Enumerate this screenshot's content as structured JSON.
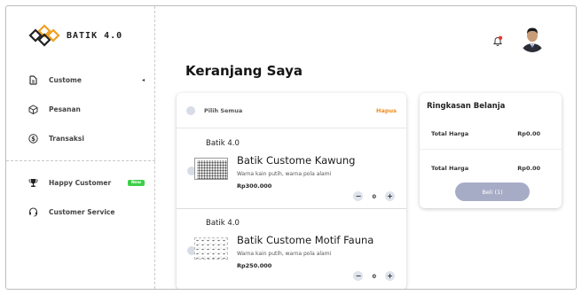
{
  "brand": {
    "name": "BATIK 4.0"
  },
  "sidebar": {
    "items": [
      {
        "label": "Custome",
        "icon": "ruler-icon"
      },
      {
        "label": "Pesanan",
        "icon": "box-icon"
      },
      {
        "label": "Transaksi",
        "icon": "dollar-icon"
      },
      {
        "label": "Happy Customer",
        "icon": "trophy-icon",
        "badge": "New"
      },
      {
        "label": "Customer Service",
        "icon": "headset-icon"
      }
    ]
  },
  "header": {
    "title": "Keranjang Saya"
  },
  "cart": {
    "select_all_label": "Pilih Semua",
    "delete_label": "Hapus",
    "items": [
      {
        "store": "Batik 4.0",
        "name": "Batik Custome Kawung",
        "description": "Warna kain putih, warna pola alami",
        "price": "Rp300.000",
        "quantity": "0"
      },
      {
        "store": "Batik 4.0",
        "name": "Batik Custome Motif Fauna",
        "description": "Warna kain putih, warna pola alami",
        "price": "Rp250.000",
        "quantity": "0"
      }
    ],
    "minus": "−",
    "plus": "+"
  },
  "summary": {
    "title": "Ringkasan Belanja",
    "total_price_label": "Total Harga",
    "total_price_value": "Rp0.00",
    "grand_total_label": "Total Harga",
    "grand_total_value": "Rp0.00",
    "buy_label": "Beli (1)"
  },
  "colors": {
    "accent_orange": "#f28a1c",
    "buy_button": "#a7acc6",
    "badge_green": "#3ecf4a",
    "notification_red": "#e53935"
  }
}
